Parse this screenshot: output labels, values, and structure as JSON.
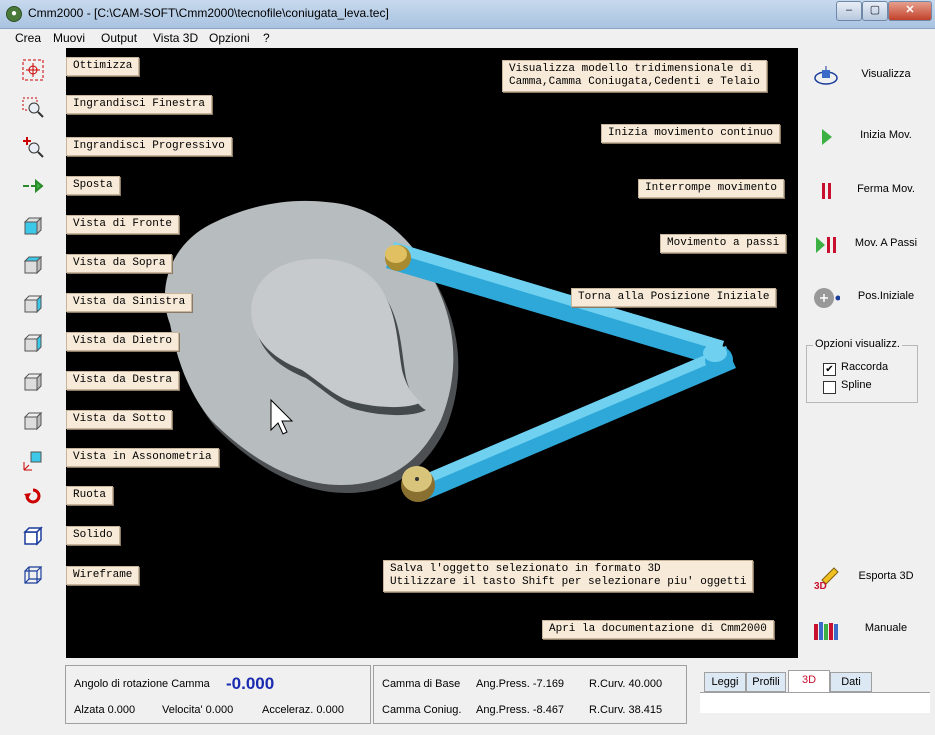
{
  "window": {
    "title": "Cmm2000 - [C:\\CAM-SOFT\\Cmm2000\\tecnofile\\coniugata_leva.tec]",
    "minimize": "–",
    "maximize": "▢",
    "close": "✕"
  },
  "menu": [
    "Crea",
    "Muovi",
    "Output",
    "Vista 3D",
    "Opzioni",
    "?"
  ],
  "toolbar": [
    {
      "label": "Ottimizza",
      "icon": "optimize-icon"
    },
    {
      "label": "Ingrandisci Finestra",
      "icon": "zoom-window-icon"
    },
    {
      "label": "Ingrandisci Progressivo",
      "icon": "zoom-progressive-icon"
    },
    {
      "label": "Sposta",
      "icon": "pan-arrow-icon"
    },
    {
      "label": "Vista di Fronte",
      "icon": "cube-front-icon"
    },
    {
      "label": "Vista da Sopra",
      "icon": "cube-top-icon"
    },
    {
      "label": "Vista da Sinistra",
      "icon": "cube-left-icon"
    },
    {
      "label": "Vista da Dietro",
      "icon": "cube-back-icon"
    },
    {
      "label": "Vista da Destra",
      "icon": "cube-right-icon"
    },
    {
      "label": "Vista da Sotto",
      "icon": "cube-bottom-icon"
    },
    {
      "label": "Vista in Assonometria",
      "icon": "axonometric-icon"
    },
    {
      "label": "Ruota",
      "icon": "rotate-icon"
    },
    {
      "label": "Solido",
      "icon": "solid-cube-icon"
    },
    {
      "label": "Wireframe",
      "icon": "wireframe-cube-icon"
    }
  ],
  "tooltips": {
    "visualizza": "Visualizza modello tridimensionale di\nCamma,Camma Coniugata,Cedenti e Telaio",
    "inizia": "Inizia movimento continuo",
    "interrompe": "Interrompe movimento",
    "passi": "Movimento a passi",
    "torna": "Torna alla Posizione Iniziale",
    "salva": "Salva l'oggetto selezionato in formato 3D\nUtilizzare il tasto Shift per selezionare piu' oggetti",
    "apri": "Apri la documentazione di Cmm2000"
  },
  "right_buttons": [
    {
      "label": "Visualizza",
      "icon": "visualize-3d-icon"
    },
    {
      "label": "Inizia Mov.",
      "icon": "play-icon"
    },
    {
      "label": "Ferma Mov.",
      "icon": "pause-icon"
    },
    {
      "label": "Mov. A Passi",
      "icon": "step-icon"
    },
    {
      "label": "Pos.Iniziale",
      "icon": "home-position-icon"
    },
    {
      "label": "Esporta 3D",
      "icon": "export-3d-icon"
    },
    {
      "label": "Manuale",
      "icon": "manual-books-icon"
    }
  ],
  "options": {
    "title": "Opzioni visualizz.",
    "raccorda": {
      "label": "Raccorda",
      "checked": true
    },
    "spline": {
      "label": "Spline",
      "checked": false
    }
  },
  "status": {
    "angle_label": "Angolo di rotazione Camma",
    "angle_value": "-0.000",
    "alzata": "Alzata  0.000",
    "velocita": "Velocita'  0.000",
    "acceleraz": "Acceleraz.  0.000",
    "base_label": "Camma di Base",
    "base_press": "Ang.Press.   -7.169",
    "base_curv": "R.Curv.   40.000",
    "coniug_label": "Camma Coniug.",
    "coniug_press": "Ang.Press.   -8.467",
    "coniug_curv": "R.Curv.   38.415"
  },
  "tabs": [
    "Leggi",
    "Profili",
    "3D",
    "Dati"
  ],
  "active_tab": "3D"
}
